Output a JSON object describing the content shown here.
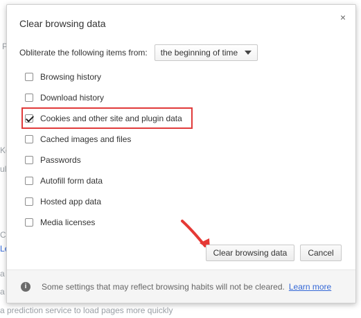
{
  "background": {
    "hints": [
      "P",
      "Ko",
      "ul",
      "Ch",
      "Le",
      "a",
      "a"
    ],
    "bottom_text": "a prediction service to load pages more quickly"
  },
  "dialog": {
    "title": "Clear browsing data",
    "close_glyph": "×",
    "from_label": "Obliterate the following items from:",
    "time_range_selected": "the beginning of time",
    "items": [
      {
        "label": "Browsing history",
        "checked": false
      },
      {
        "label": "Download history",
        "checked": false
      },
      {
        "label": "Cookies and other site and plugin data",
        "checked": true
      },
      {
        "label": "Cached images and files",
        "checked": false
      },
      {
        "label": "Passwords",
        "checked": false
      },
      {
        "label": "Autofill form data",
        "checked": false
      },
      {
        "label": "Hosted app data",
        "checked": false
      },
      {
        "label": "Media licenses",
        "checked": false
      }
    ],
    "buttons": {
      "primary_label": "Clear browsing data",
      "cancel_label": "Cancel"
    },
    "footer": {
      "info_glyph": "i",
      "text": "Some settings that may reflect browsing habits will not be cleared.",
      "link_text": "Learn more"
    }
  },
  "colors": {
    "highlight_border": "#e03a3a",
    "arrow": "#e53935",
    "link": "#3367d6"
  }
}
